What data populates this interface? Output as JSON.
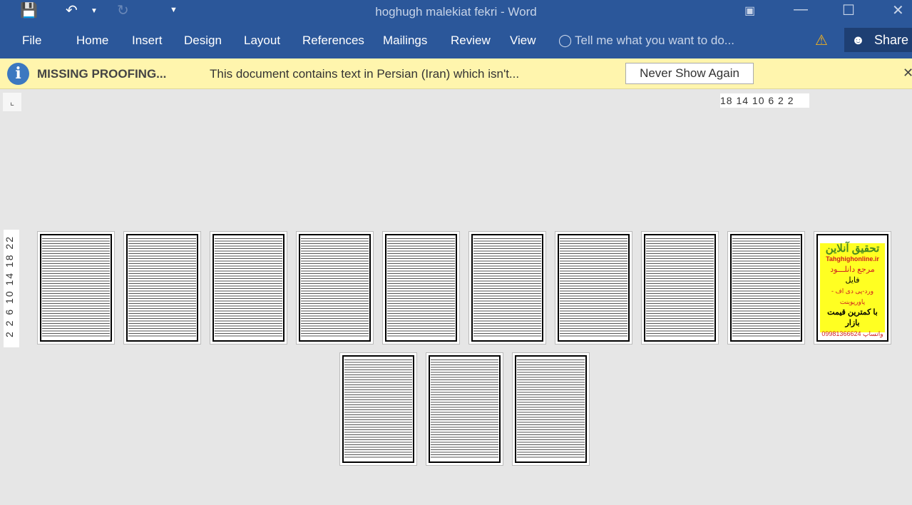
{
  "titlebar": {
    "title": "hoghugh malekiat fekri - Word"
  },
  "ribbon": {
    "tabs": [
      "File",
      "Home",
      "Insert",
      "Design",
      "Layout",
      "References",
      "Mailings",
      "Review",
      "View"
    ],
    "tell_me": "Tell me what you want to do...",
    "share": "Share"
  },
  "message_bar": {
    "title": "MISSING PROOFING...",
    "text": "This document contains text in Persian (Iran) which isn't...",
    "button": "Never Show Again"
  },
  "ruler": {
    "horizontal": "18 14 10  6   2   2",
    "vertical": "2  2  6  10 14 18 22"
  },
  "ad_page": {
    "line1": "تحقیق آنلاین",
    "line2": "Tahghighonline.ir",
    "line3": "مرجع دانلـــود",
    "line4": "فایل",
    "line5": "ورد-پی دی اف - پاورپوینت",
    "line6": "با کمترین قیمت بازار",
    "line7": "09981366624 واتساپ"
  },
  "colors": {
    "ribbon": "#2b579a",
    "message_bar": "#fff5ad"
  }
}
